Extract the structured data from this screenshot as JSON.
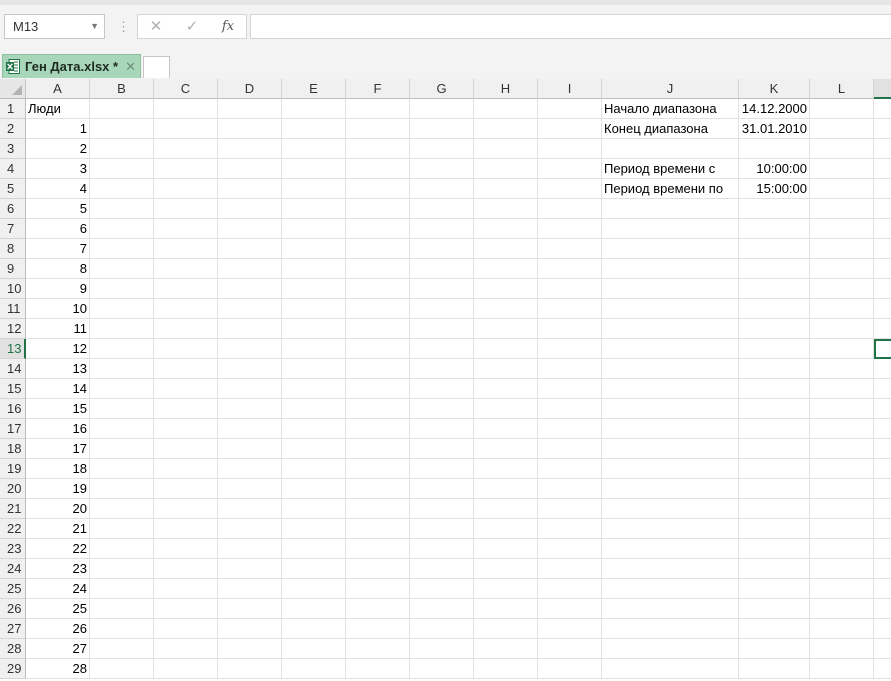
{
  "formula_bar": {
    "name_box": "M13",
    "cancel_symbol": "✕",
    "enter_symbol": "✓",
    "fx_label": "fx",
    "formula": ""
  },
  "workbook_tab": {
    "name": "Ген Дата.xlsx *",
    "close_symbol": "✕"
  },
  "selected_cell": "M13",
  "columns": [
    "A",
    "B",
    "C",
    "D",
    "E",
    "F",
    "G",
    "H",
    "I",
    "J",
    "K",
    "L"
  ],
  "rows": [
    1,
    2,
    3,
    4,
    5,
    6,
    7,
    8,
    9,
    10,
    11,
    12,
    13,
    14,
    15,
    16,
    17,
    18,
    19,
    20,
    21,
    22,
    23,
    24,
    25,
    26,
    27,
    28,
    29
  ],
  "cells": {
    "A1": "Люди",
    "A2": "1",
    "A3": "2",
    "A4": "3",
    "A5": "4",
    "A6": "5",
    "A7": "6",
    "A8": "7",
    "A9": "8",
    "A10": "9",
    "A11": "10",
    "A12": "11",
    "A13": "12",
    "A14": "13",
    "A15": "14",
    "A16": "15",
    "A17": "16",
    "A18": "17",
    "A19": "18",
    "A20": "19",
    "A21": "20",
    "A22": "21",
    "A23": "22",
    "A24": "23",
    "A25": "24",
    "A26": "25",
    "A27": "26",
    "A28": "27",
    "A29": "28",
    "J1": "Начало диапазона",
    "K1": "14.12.2000",
    "J2": "Конец диапазона",
    "K2": "31.01.2010",
    "J4": "Период времени с",
    "K4": "10:00:00",
    "J5": "Период времени по",
    "K5": "15:00:00"
  },
  "colors": {
    "accent": "#217346",
    "tab_active": "#a8d6b9"
  },
  "icons": {
    "namebox_dropdown": "chevron-down-icon",
    "excel_file": "excel-file-icon"
  }
}
